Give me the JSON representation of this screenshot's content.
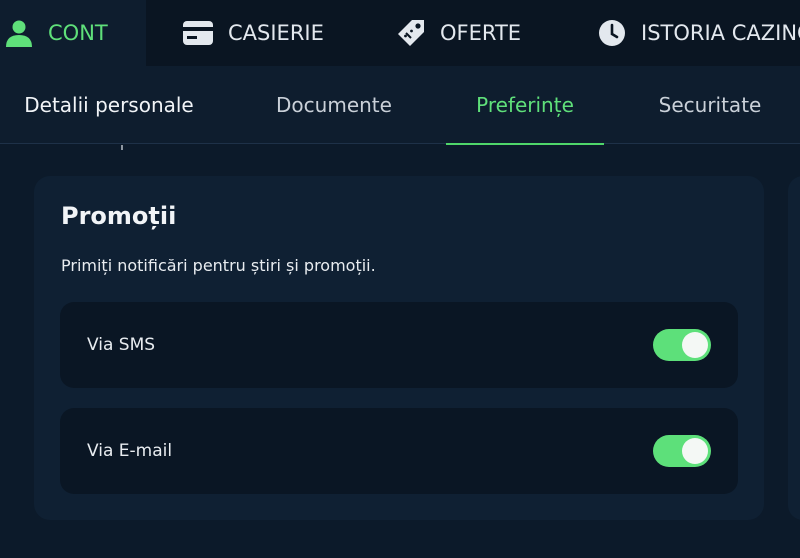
{
  "topnav": {
    "items": [
      {
        "label": "CONT",
        "icon": "user-icon",
        "active": true
      },
      {
        "label": "CASIERIE",
        "icon": "card-icon",
        "active": false
      },
      {
        "label": "OFERTE",
        "icon": "tag-icon",
        "active": false
      },
      {
        "label": "ISTORIA CAZINO",
        "icon": "clock-icon",
        "active": false
      }
    ],
    "active_color": "#5fe07a"
  },
  "tabs": [
    {
      "label": "Detalii personale",
      "active": false
    },
    {
      "label": "Documente",
      "active": false
    },
    {
      "label": "Preferințe",
      "active": true
    },
    {
      "label": "Securitate",
      "active": false
    }
  ],
  "promotions": {
    "title": "Promoții",
    "description": "Primiți notificări pentru știri și promoții.",
    "options": [
      {
        "label": "Via SMS",
        "enabled": true
      },
      {
        "label": "Via E-mail",
        "enabled": true
      }
    ],
    "toggle_on_color": "#5de07a"
  }
}
